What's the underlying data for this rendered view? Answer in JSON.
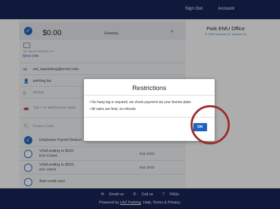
{
  "header": {
    "sign_out": "Sign Out",
    "account": "Account"
  },
  "permit": {
    "price": "$0.00",
    "type": "Emeritus",
    "caret": "^",
    "garage_label": "DR. GRACE PARKING LOT",
    "more_info": "More Info"
  },
  "account_details": {
    "email": "ext_lazparking@emich.edu",
    "username": "parking.laz",
    "mobile_placeholder": "Mobile",
    "plate_placeholder": "Tap + to add license plate",
    "promo_placeholder": "Promo Code"
  },
  "payment": {
    "payroll": "Employee Payroll Deduct",
    "cards": [
      {
        "label": "VISA ending in 8533",
        "name": "Eric Csinsi",
        "exp": "Exp 10/22"
      },
      {
        "label": "VISA ending in 8533",
        "name": "eric csinsi",
        "exp": "Exp 10/22"
      }
    ],
    "add_card": "Add credit card"
  },
  "office": {
    "title": "Park EMU Office",
    "address": "1300 Oakwood St, Ypsilanti, MI"
  },
  "modal": {
    "title": "Restrictions",
    "bullets": [
      "No hang tag is required, we check payment via your license plate",
      "All sales are final, no refunds"
    ],
    "ok": "OK"
  },
  "footer": {
    "email_us": "Email us",
    "call_us": "Call us",
    "faqs": "FAQs",
    "powered_prefix": "Powered by ",
    "powered_link": "LAZ Parking",
    "powered_suffix": ". Help, Terms & Privacy."
  },
  "colors": {
    "nav_bg": "#0f1d52",
    "accent": "#1e63bf",
    "annotation_circle": "#9e2b2b"
  }
}
